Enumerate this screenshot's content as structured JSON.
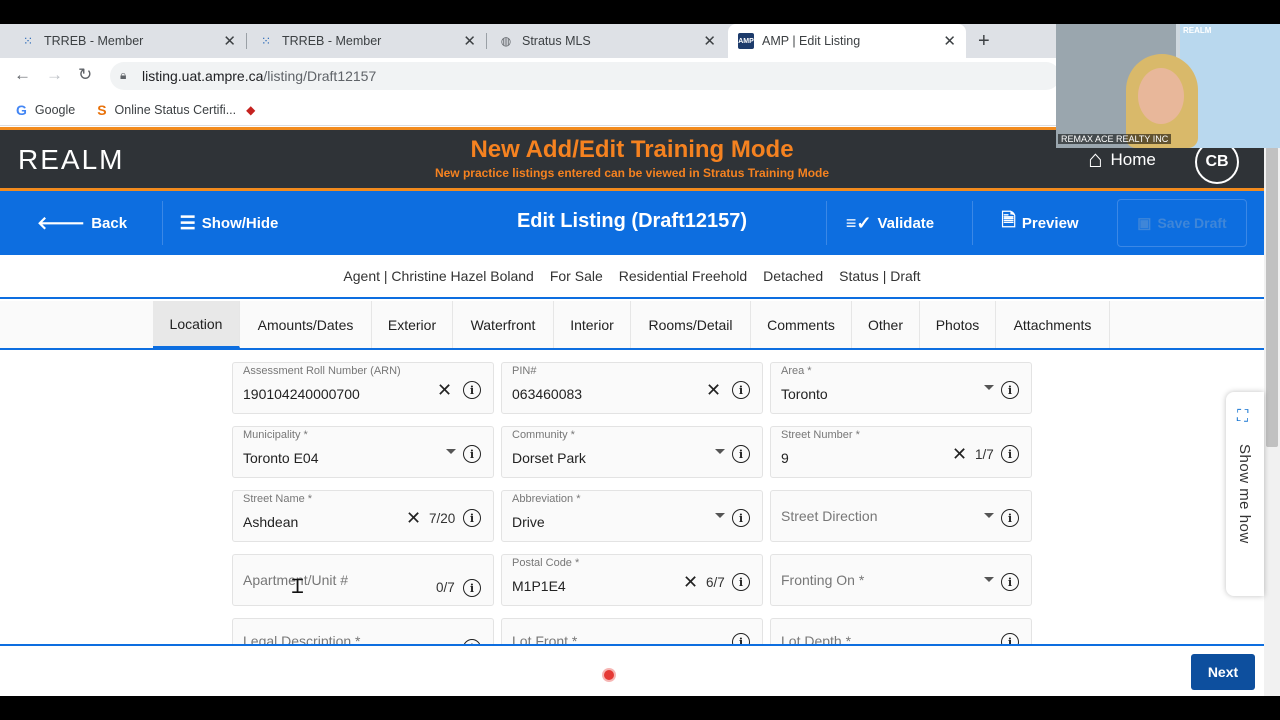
{
  "browser": {
    "tabs": [
      {
        "title": "TRREB - Member",
        "icon": "trreb-icon"
      },
      {
        "title": "TRREB - Member",
        "icon": "trreb-icon"
      },
      {
        "title": "Stratus MLS",
        "icon": "globe-icon"
      },
      {
        "title": "AMP | Edit Listing",
        "icon": "amp-icon"
      }
    ],
    "url_host": "listing.uat.ampre.ca",
    "url_path": "/listing/Draft12157",
    "bookmarks": [
      "Google",
      "Online Status Certifi..."
    ]
  },
  "header": {
    "logo": "REALM",
    "training_title": "New Add/Edit Training Mode",
    "training_subtitle": "New practice listings entered can be viewed in Stratus Training Mode",
    "home_label": "Home",
    "avatar_initials": "CB"
  },
  "toolbar": {
    "back": "Back",
    "show_hide": "Show/Hide",
    "title": "Edit Listing (Draft12157)",
    "validate": "Validate",
    "preview": "Preview",
    "save_draft": "Save Draft"
  },
  "summary": {
    "agent": "Agent | Christine Hazel Boland",
    "sale_type": "For Sale",
    "property_class": "Residential Freehold",
    "style": "Detached",
    "status": "Status | Draft"
  },
  "listing_tabs": [
    "Location",
    "Amounts/Dates",
    "Exterior",
    "Waterfront",
    "Interior",
    "Rooms/Detail",
    "Comments",
    "Other",
    "Photos",
    "Attachments"
  ],
  "fields": {
    "arn": {
      "label": "Assessment Roll Number (ARN)",
      "value": "190104240000700"
    },
    "pin": {
      "label": "PIN#",
      "value": "063460083"
    },
    "area": {
      "label": "Area *",
      "value": "Toronto"
    },
    "municipality": {
      "label": "Municipality *",
      "value": "Toronto E04"
    },
    "community": {
      "label": "Community *",
      "value": "Dorset Park"
    },
    "street_number": {
      "label": "Street Number *",
      "value": "9",
      "count": "1/7"
    },
    "street_name": {
      "label": "Street Name *",
      "value": "Ashdean",
      "count": "7/20"
    },
    "abbreviation": {
      "label": "Abbreviation *",
      "value": "Drive"
    },
    "street_direction": {
      "placeholder": "Street Direction"
    },
    "apartment_unit": {
      "placeholder": "Apartment/Unit #",
      "count": "0/7"
    },
    "postal_code": {
      "label": "Postal Code *",
      "value": "M1P1E4",
      "count": "6/7"
    },
    "fronting_on": {
      "placeholder": "Fronting On *"
    },
    "legal_description": {
      "placeholder": "Legal Description *"
    },
    "lot_front": {
      "placeholder": "Lot Front *"
    },
    "lot_depth": {
      "placeholder": "Lot Depth *"
    }
  },
  "footer": {
    "next": "Next"
  },
  "side_panel": {
    "show_me_how": "Show me how"
  },
  "webcam": {
    "caption": "REMAX ACE REALTY INC",
    "tag": "REALM"
  }
}
